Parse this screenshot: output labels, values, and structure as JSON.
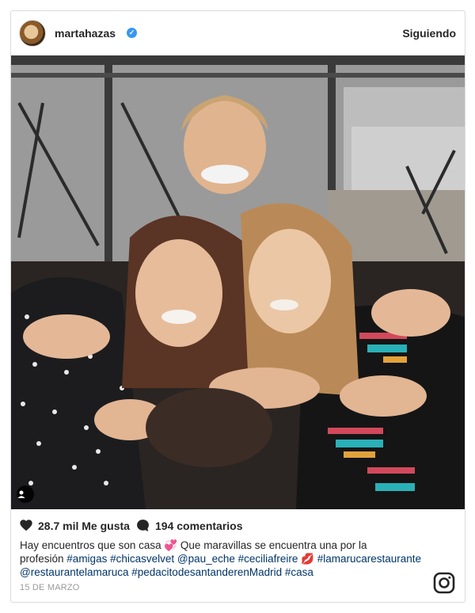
{
  "post": {
    "username": "martahazas",
    "verified_mark": "✓",
    "follow_label": "Siguiendo",
    "likes": "28.7 mil Me gusta",
    "comments": "194 comentarios",
    "caption_line1": "Hay encuentros que son casa 💞 Que maravillas se encuentra una por la",
    "caption_line2_text": "profesión ",
    "caption_tags_line2": "#amigas #chicasvelvet @pau_eche #ceciliafreire",
    "caption_emoji": " 💋 ",
    "caption_tag_line2b": "#lamarucarestaurante",
    "caption_line3": "@restaurantelamaruca #pedacitodesantanderenMadrid #casa",
    "date": "15 DE MARZO"
  },
  "icons": {
    "heart": "heart-icon",
    "comment": "comment-icon",
    "instagram": "instagram-logo-icon",
    "user_tag": "user-tag-icon"
  },
  "colors": {
    "link": "#003569",
    "verified": "#3897f0",
    "muted": "#999999"
  }
}
